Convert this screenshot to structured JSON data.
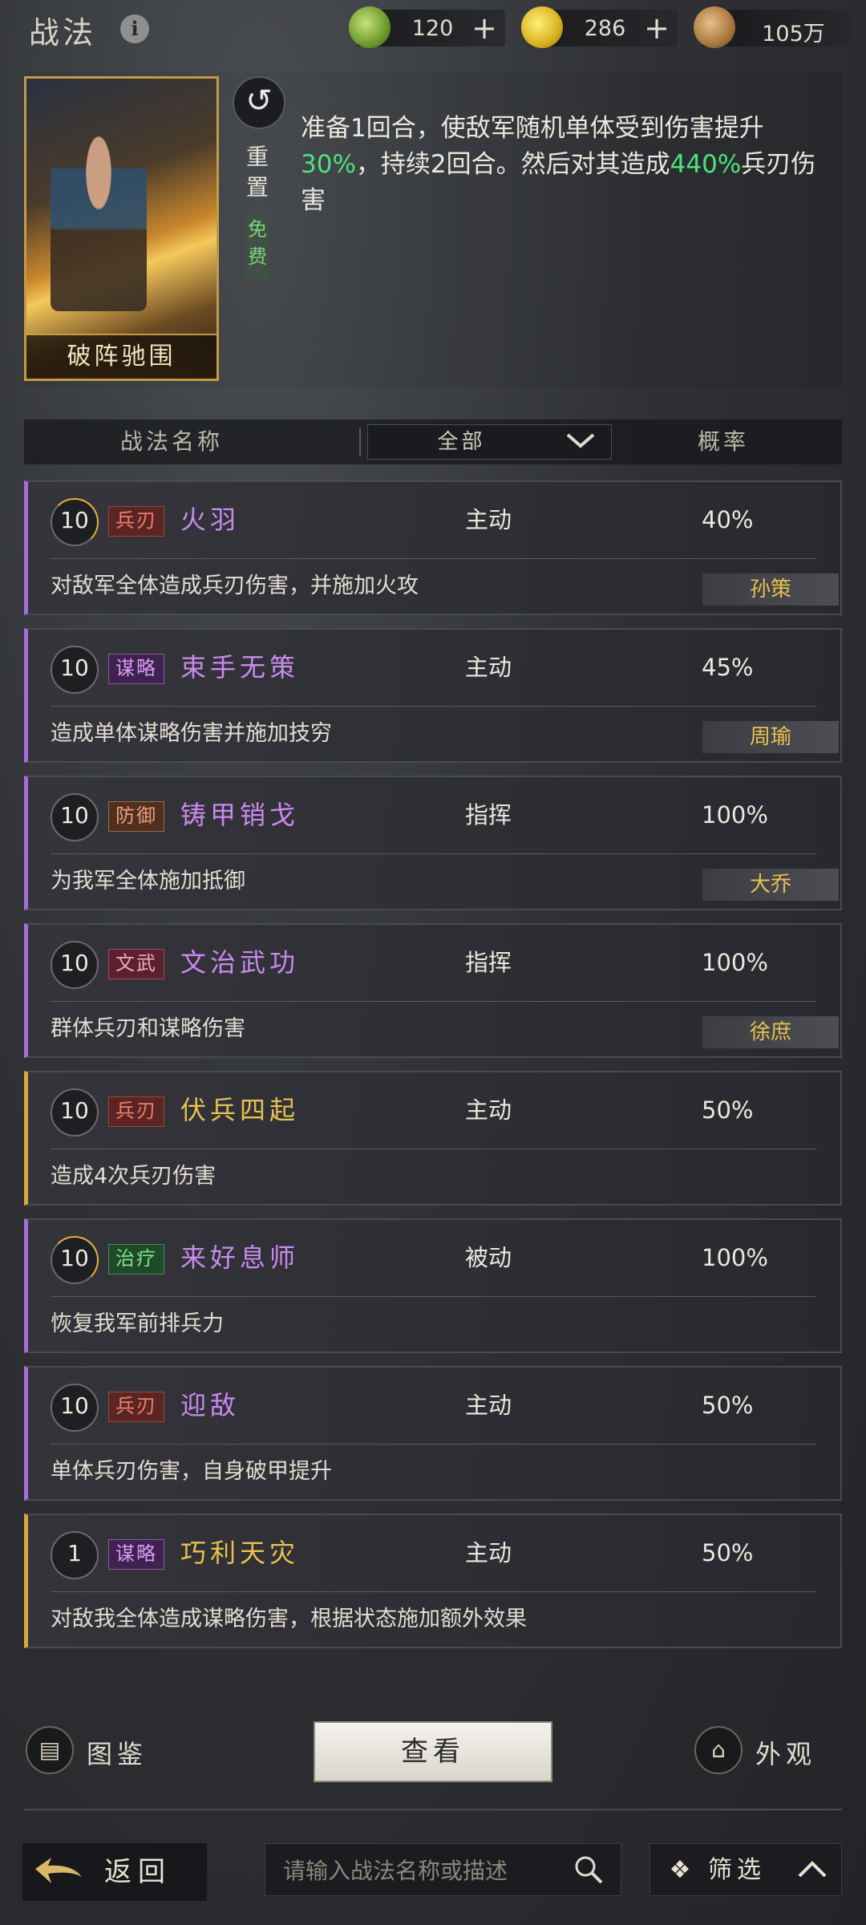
{
  "header": {
    "title": "战法",
    "currencies": [
      {
        "icon": "jade-coin-icon",
        "value": "120",
        "has_plus": true,
        "color": "#8fc148"
      },
      {
        "icon": "gold-coin-icon",
        "value": "286",
        "has_plus": true,
        "color": "#e2c02a"
      },
      {
        "icon": "copper-coin-icon",
        "value": "105万",
        "has_plus": false,
        "color": "#b9874a"
      }
    ]
  },
  "featured": {
    "name": "破阵驰围",
    "reset_label": "重置",
    "free_label": "免费",
    "desc_parts": [
      "准备1回合，使敌军随机单体受到伤害提升",
      "30%",
      "，持续2回合。然后对其造成",
      "440%",
      "兵刃伤害"
    ]
  },
  "list_header": {
    "name_col": "战法名称",
    "filter_value": "全部",
    "rate_col": "概率"
  },
  "tactics": [
    {
      "level": "10",
      "type_tag": "兵刃",
      "name": "火羽",
      "kind": "主动",
      "rate": "40%",
      "desc": "对敌军全体造成兵刃伤害，并施加火攻",
      "hero": "孙策"
    },
    {
      "level": "10",
      "type_tag": "谋略",
      "name": "束手无策",
      "kind": "主动",
      "rate": "45%",
      "desc": "造成单体谋略伤害并施加技穷",
      "hero": "周瑜"
    },
    {
      "level": "10",
      "type_tag": "防御",
      "name": "铸甲销戈",
      "kind": "指挥",
      "rate": "100%",
      "desc": "为我军全体施加抵御",
      "hero": "大乔"
    },
    {
      "level": "10",
      "type_tag": "文武",
      "name": "文治武功",
      "kind": "指挥",
      "rate": "100%",
      "desc": "群体兵刃和谋略伤害",
      "hero": "徐庶"
    },
    {
      "level": "10",
      "type_tag": "兵刃",
      "name": "伏兵四起",
      "kind": "主动",
      "rate": "50%",
      "desc": "造成4次兵刃伤害",
      "hero": ""
    },
    {
      "level": "10",
      "type_tag": "治疗",
      "name": "来好息师",
      "kind": "被动",
      "rate": "100%",
      "desc": "恢复我军前排兵力",
      "hero": ""
    },
    {
      "level": "10",
      "type_tag": "兵刃",
      "name": "迎敌",
      "kind": "主动",
      "rate": "50%",
      "desc": "单体兵刃伤害，自身破甲提升",
      "hero": ""
    },
    {
      "level": "1",
      "type_tag": "谋略",
      "name": "巧利天灾",
      "kind": "主动",
      "rate": "50%",
      "desc": "对敌我全体造成谋略伤害，根据状态施加额外效果",
      "hero": ""
    }
  ],
  "actions": {
    "codex_label": "图鉴",
    "view_label": "查看",
    "appearance_label": "外观"
  },
  "bottom_bar": {
    "back_label": "返回",
    "search_placeholder": "请输入战法名称或描述",
    "filter_label": "筛选"
  },
  "colors": {
    "purple_quality": "#a66ed8",
    "gold_quality": "#d3ac3d",
    "highlight_green": "#4ee37a",
    "hero_tag_text": "#e9c24e"
  }
}
